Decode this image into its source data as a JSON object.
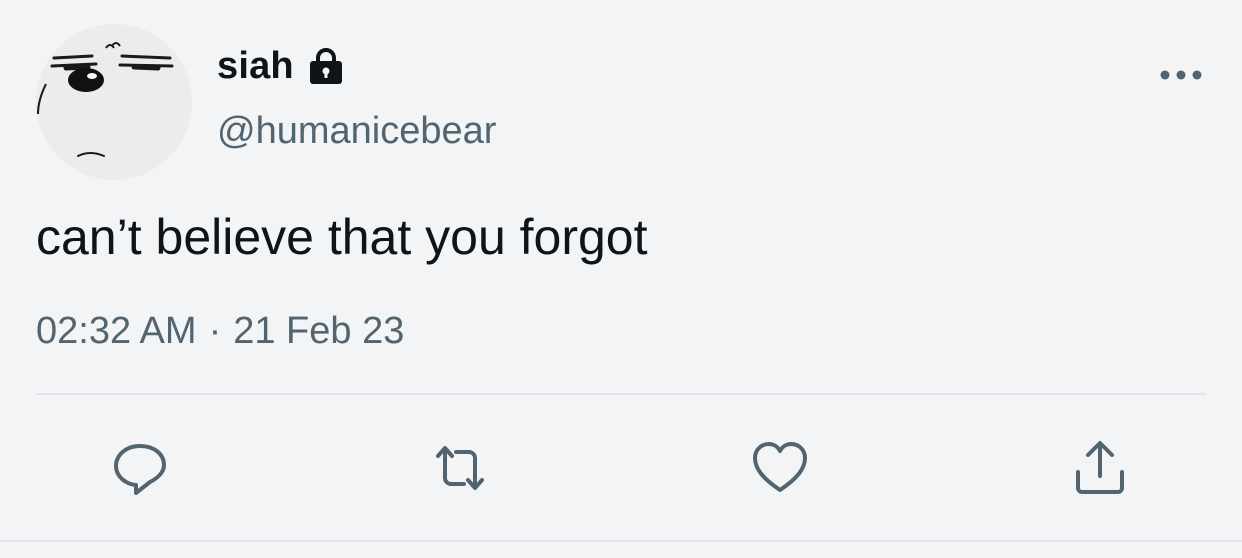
{
  "user": {
    "display_name": "siah",
    "handle": "@humanicebear",
    "avatar_icon": "cartoon-face-avatar",
    "protected_icon": "lock-icon"
  },
  "tweet": {
    "text": "can’t believe that you forgot",
    "time": "02:32 AM",
    "separator": "·",
    "date": "21 Feb 23"
  },
  "actions": {
    "reply_icon": "reply-icon",
    "retweet_icon": "retweet-icon",
    "like_icon": "heart-icon",
    "share_icon": "share-icon",
    "more_icon": "more-icon"
  },
  "colors": {
    "background": "#f3f4f6",
    "primary_text": "#0f1419",
    "secondary_text": "#536471",
    "divider": "#e1e4e8"
  }
}
